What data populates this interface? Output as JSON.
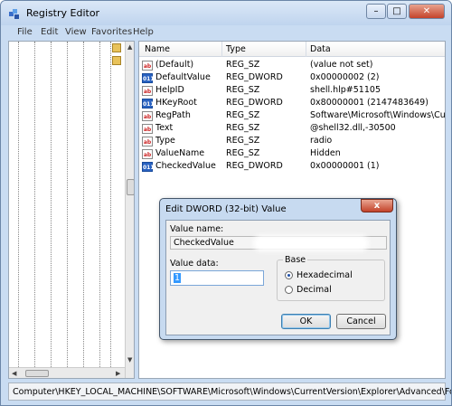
{
  "window": {
    "title": "Registry Editor"
  },
  "menu": [
    "File",
    "Edit",
    "View",
    "Favorites",
    "Help"
  ],
  "list": {
    "headers": {
      "name": "Name",
      "type": "Type",
      "data": "Data"
    },
    "rows": [
      {
        "icon": "string-value-icon",
        "name": "(Default)",
        "type": "REG_SZ",
        "data": "(value not set)"
      },
      {
        "icon": "dword-value-icon",
        "name": "DefaultValue",
        "type": "REG_DWORD",
        "data": "0x00000002 (2)"
      },
      {
        "icon": "string-value-icon",
        "name": "HelpID",
        "type": "REG_SZ",
        "data": "shell.hlp#51105"
      },
      {
        "icon": "dword-value-icon",
        "name": "HKeyRoot",
        "type": "REG_DWORD",
        "data": "0x80000001 (2147483649)"
      },
      {
        "icon": "string-value-icon",
        "name": "RegPath",
        "type": "REG_SZ",
        "data": "Software\\Microsoft\\Windows\\Current"
      },
      {
        "icon": "string-value-icon",
        "name": "Text",
        "type": "REG_SZ",
        "data": "@shell32.dll,-30500"
      },
      {
        "icon": "string-value-icon",
        "name": "Type",
        "type": "REG_SZ",
        "data": "radio"
      },
      {
        "icon": "string-value-icon",
        "name": "ValueName",
        "type": "REG_SZ",
        "data": "Hidden"
      },
      {
        "icon": "dword-value-icon",
        "name": "CheckedValue",
        "type": "REG_DWORD",
        "data": "0x00000001 (1)"
      }
    ]
  },
  "dialog": {
    "title": "Edit DWORD (32-bit) Value",
    "close_label": "x",
    "value_name_label": "Value name:",
    "value_name": "CheckedValue",
    "value_data_label": "Value data:",
    "value_data": "1",
    "base_label": "Base",
    "hex_label": "Hexadecimal",
    "dec_label": "Decimal",
    "selected_base": "Hexadecimal",
    "ok_label": "OK",
    "cancel_label": "Cancel"
  },
  "status": {
    "path": "Computer\\HKEY_LOCAL_MACHINE\\SOFTWARE\\Microsoft\\Windows\\CurrentVersion\\Explorer\\Advanced\\Folder\\Hidden\\SHOWALL"
  }
}
